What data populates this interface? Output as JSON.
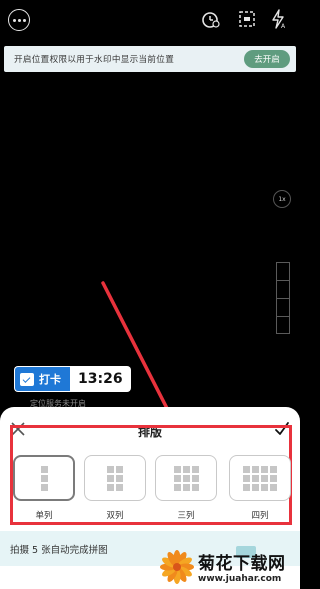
{
  "location_banner": {
    "text": "开启位置权限以用于水印中显示当前位置",
    "button_label": "去开启"
  },
  "camera": {
    "zoom_label": "1x"
  },
  "watermark": {
    "label": "打卡",
    "time": "13:26",
    "sub_text": "定位服务未开启"
  },
  "layout_sheet": {
    "title": "排版",
    "options": [
      {
        "label": "单列",
        "selected": true
      },
      {
        "label": "双列",
        "selected": false
      },
      {
        "label": "三列",
        "selected": false
      },
      {
        "label": "四列",
        "selected": false
      }
    ]
  },
  "bottom_bar": {
    "text": "拍摄 5 张自动完成拼图"
  },
  "brand_logo": {
    "name": "菊花下载网",
    "url": "www.juahar.com"
  },
  "colors": {
    "highlight": "#e8323c",
    "accent_green": "#5f9c7f",
    "watermark_blue": "#1f78d6"
  }
}
